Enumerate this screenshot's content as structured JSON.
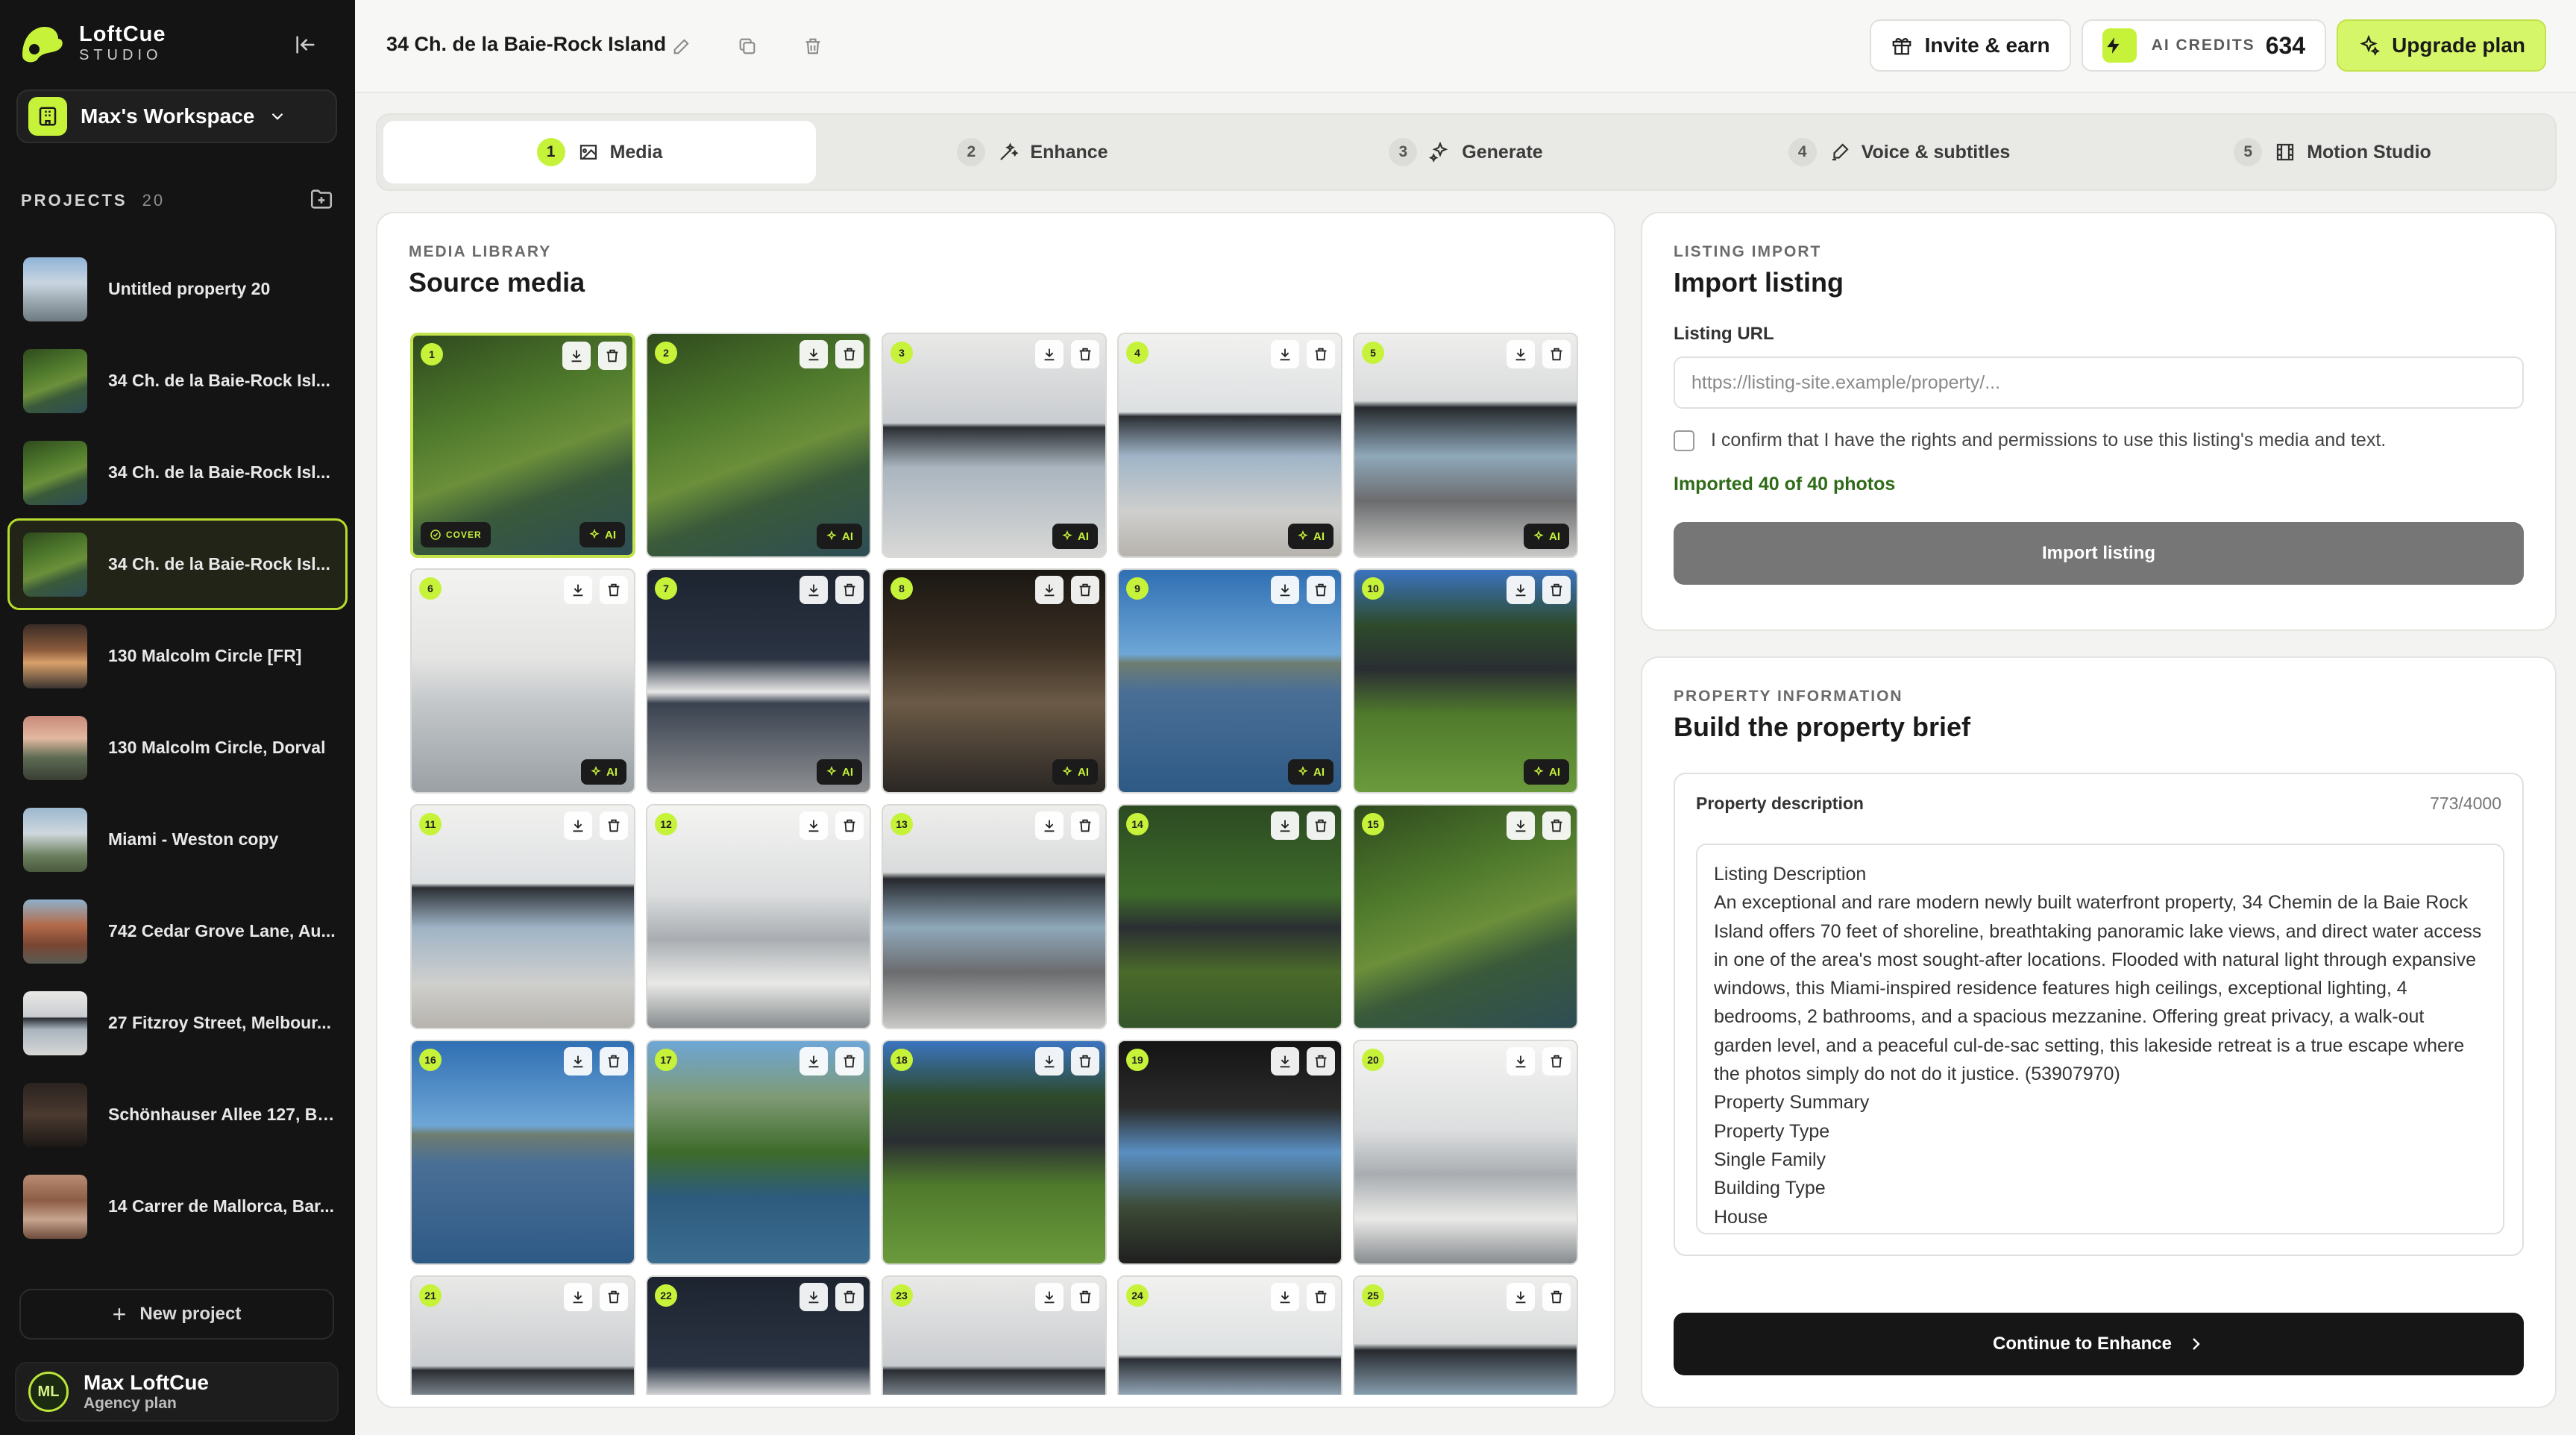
{
  "brand": {
    "name": "LoftCue",
    "sub": "STUDIO"
  },
  "workspace": {
    "name": "Max's Workspace"
  },
  "projects": {
    "label": "PROJECTS",
    "count": "20",
    "items": [
      {
        "name": "Untitled property 20",
        "thumb": "city",
        "active": false
      },
      {
        "name": "34 Ch. de la Baie-Rock Isl...",
        "thumb": "aerial",
        "active": false
      },
      {
        "name": "34 Ch. de la Baie-Rock Isl...",
        "thumb": "aerial",
        "active": false
      },
      {
        "name": "34 Ch. de la Baie-Rock Isl...",
        "thumb": "aerial",
        "active": true
      },
      {
        "name": "130 Malcolm Circle [FR]",
        "thumb": "dusk",
        "active": false
      },
      {
        "name": "130 Malcolm Circle, Dorval",
        "thumb": "sunset",
        "active": false
      },
      {
        "name": "Miami - Weston copy",
        "thumb": "house",
        "active": false
      },
      {
        "name": "742 Cedar Grove Lane, Au...",
        "thumb": "brick",
        "active": false
      },
      {
        "name": "27 Fitzroy Street, Melbour...",
        "thumb": "interior",
        "active": false
      },
      {
        "name": "Schönhauser Allee 127, Be...",
        "thumb": "dark",
        "active": false
      },
      {
        "name": "14 Carrer de Mallorca, Bar...",
        "thumb": "facade",
        "active": false
      }
    ],
    "new_label": "New project"
  },
  "user": {
    "initials": "ML",
    "name": "Max LoftCue",
    "plan": "Agency plan"
  },
  "topbar": {
    "title": "34 Ch. de la Baie-Rock Island",
    "invite": "Invite & earn",
    "credits_label": "AI CREDITS",
    "credits_value": "634",
    "upgrade": "Upgrade plan"
  },
  "steps": [
    {
      "num": "1",
      "label": "Media",
      "active": true
    },
    {
      "num": "2",
      "label": "Enhance",
      "active": false
    },
    {
      "num": "3",
      "label": "Generate",
      "active": false
    },
    {
      "num": "4",
      "label": "Voice & subtitles",
      "active": false
    },
    {
      "num": "5",
      "label": "Motion Studio",
      "active": false
    }
  ],
  "media": {
    "eyebrow": "MEDIA LIBRARY",
    "title": "Source media",
    "ai_label": "AI",
    "cover_label": "COVER",
    "tiles": [
      {
        "n": "1",
        "scene": "aerial",
        "ai": true,
        "cover": true
      },
      {
        "n": "2",
        "scene": "aerial",
        "ai": true,
        "cover": false
      },
      {
        "n": "3",
        "scene": "interior",
        "ai": true,
        "cover": false
      },
      {
        "n": "4",
        "scene": "living",
        "ai": true,
        "cover": false
      },
      {
        "n": "5",
        "scene": "dining",
        "ai": true,
        "cover": false
      },
      {
        "n": "6",
        "scene": "office",
        "ai": true,
        "cover": false
      },
      {
        "n": "7",
        "scene": "entry",
        "ai": true,
        "cover": false
      },
      {
        "n": "8",
        "scene": "spa",
        "ai": true,
        "cover": false
      },
      {
        "n": "9",
        "scene": "dock",
        "ai": true,
        "cover": false
      },
      {
        "n": "10",
        "scene": "yard",
        "ai": true,
        "cover": false
      },
      {
        "n": "11",
        "scene": "living",
        "ai": false,
        "cover": false
      },
      {
        "n": "12",
        "scene": "kitchen",
        "ai": false,
        "cover": false
      },
      {
        "n": "13",
        "scene": "dining",
        "ai": false,
        "cover": false
      },
      {
        "n": "14",
        "scene": "aerial-house",
        "ai": false,
        "cover": false
      },
      {
        "n": "15",
        "scene": "aerial",
        "ai": false,
        "cover": false
      },
      {
        "n": "16",
        "scene": "dock",
        "ai": false,
        "cover": false
      },
      {
        "n": "17",
        "scene": "lake",
        "ai": false,
        "cover": false
      },
      {
        "n": "18",
        "scene": "yard",
        "ai": false,
        "cover": false
      },
      {
        "n": "19",
        "scene": "terrace",
        "ai": false,
        "cover": false
      },
      {
        "n": "20",
        "scene": "kitchen",
        "ai": false,
        "cover": false
      },
      {
        "n": "21",
        "scene": "interior",
        "ai": false,
        "cover": false
      },
      {
        "n": "22",
        "scene": "entry",
        "ai": false,
        "cover": false
      },
      {
        "n": "23",
        "scene": "interior",
        "ai": false,
        "cover": false
      },
      {
        "n": "24",
        "scene": "living",
        "ai": false,
        "cover": false
      },
      {
        "n": "25",
        "scene": "dining",
        "ai": false,
        "cover": false
      }
    ]
  },
  "import": {
    "eyebrow": "LISTING IMPORT",
    "title": "Import listing",
    "url_label": "Listing URL",
    "url_placeholder": "https://listing-site.example/property/...",
    "url_value": "",
    "confirm": "I confirm that I have the rights and permissions to use this listing's media and text.",
    "status": "Imported 40 of 40 photos",
    "button": "Import listing"
  },
  "info": {
    "eyebrow": "PROPERTY INFORMATION",
    "title": "Build the property brief",
    "desc_label": "Property description",
    "desc_count": "773/4000",
    "desc_text": "Listing Description\nAn exceptional and rare modern newly built waterfront property, 34 Chemin de la Baie Rock Island offers 70 feet of shoreline, breathtaking panoramic lake views, and direct water access in one of the area's most sought-after locations. Flooded with natural light through expansive windows, this Miami-inspired residence features high ceilings, exceptional lighting, 4 bedrooms, 2 bathrooms, and a spacious mezzanine. Offering great privacy, a walk-out garden level, and a peaceful cul-de-sac setting, this lakeside retreat is a true escape where the photos simply do not do it justice. (53907970)\nProperty Summary\nProperty Type\nSingle Family\nBuilding Type\nHouse",
    "continue": "Continue to Enhance"
  },
  "colors": {
    "accent": "#c7f23a",
    "sidebar": "#141414",
    "success": "#2f6b18"
  }
}
